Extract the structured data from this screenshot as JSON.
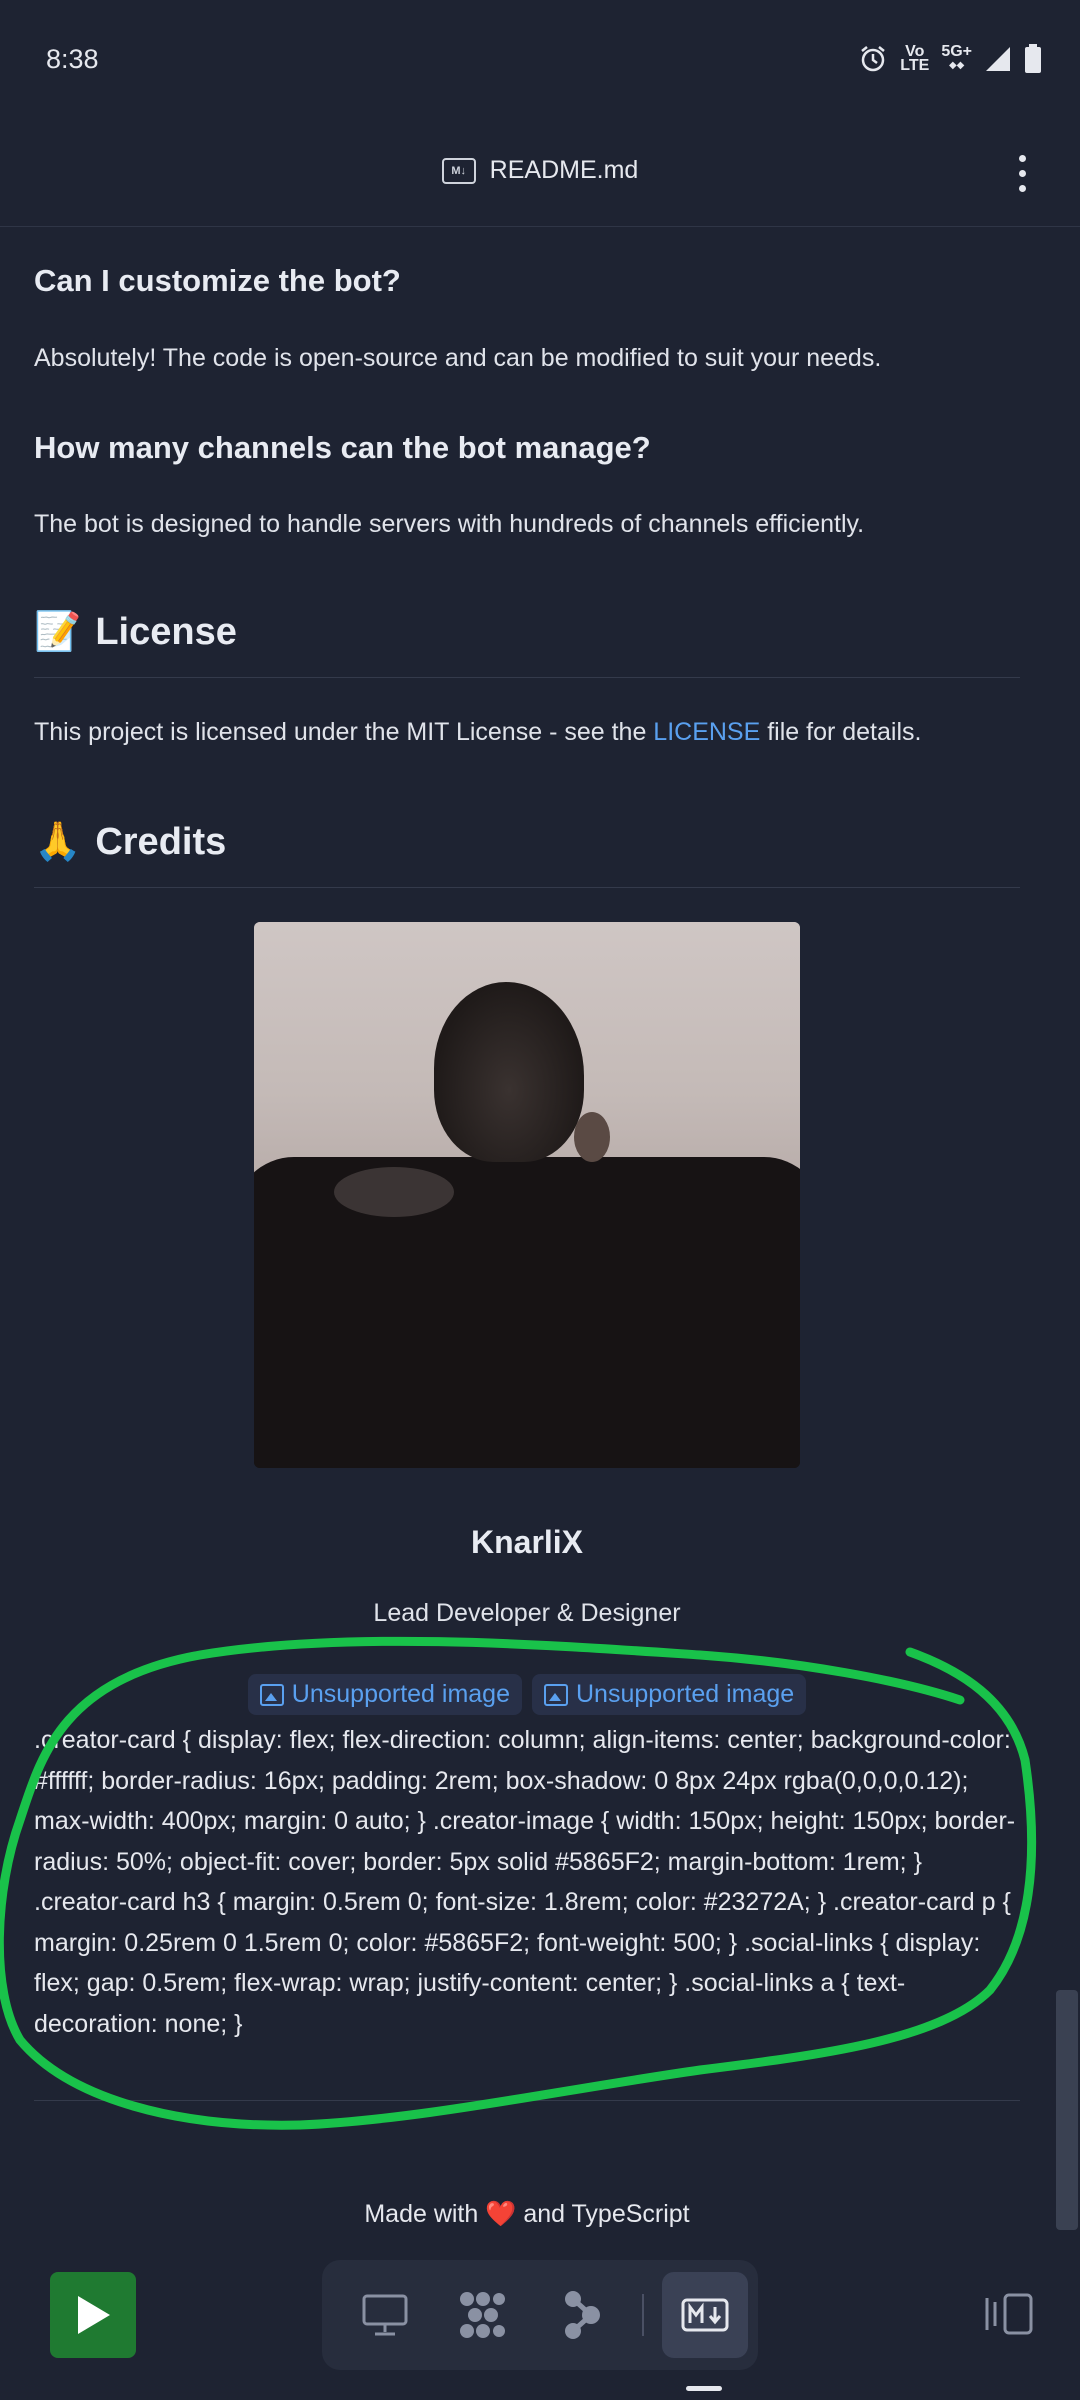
{
  "status_bar": {
    "time": "8:38",
    "icons": [
      "alarm-icon",
      "volte-icon",
      "5g-icon",
      "signal-icon",
      "battery-icon"
    ],
    "volte_top": "Vo",
    "volte_bottom": "LTE",
    "network": "5G+"
  },
  "app_bar": {
    "title": "README.md",
    "badge": "M↓"
  },
  "faq": [
    {
      "question": "Can I customize the bot?",
      "answer": "Absolutely! The code is open-source and can be modified to suit your needs."
    },
    {
      "question": "How many channels can the bot manage?",
      "answer": "The bot is designed to handle servers with hundreds of channels efficiently."
    }
  ],
  "license": {
    "emoji": "📝",
    "heading": "License",
    "text_before": "This project is licensed under the MIT License - see the ",
    "link": "LICENSE",
    "text_after": " file for details."
  },
  "credits": {
    "emoji": "🙏",
    "heading": "Credits",
    "name": "KnarliX",
    "role": "Lead Developer & Designer",
    "unsupported_images": [
      "Unsupported image",
      "Unsupported image"
    ],
    "css_text": ".creator-card { display: flex; flex-direction: column; align-items: center; background-color: #ffffff; border-radius: 16px; padding: 2rem; box-shadow: 0 8px 24px rgba(0,0,0,0.12); max-width: 400px; margin: 0 auto; } .creator-image { width: 150px; height: 150px; border-radius: 50%; object-fit: cover; border: 5px solid #5865F2; margin-bottom: 1rem; } .creator-card h3 { margin: 0.5rem 0; font-size: 1.8rem; color: #23272A; } .creator-card p { margin: 0.25rem 0 1.5rem 0; color: #5865F2; font-weight: 500; } .social-links { display: flex; gap: 0.5rem; flex-wrap: wrap; justify-content: center; } .social-links a { text-decoration: none; }"
  },
  "footer": {
    "text_before": "Made with ",
    "heart": "❤️",
    "text_after": " and TypeScript"
  },
  "colors": {
    "background": "#1e2332",
    "link": "#5aa0ef",
    "play": "#1f7a31",
    "annotation": "#19c24a"
  },
  "toolbar": {
    "play": "play-icon",
    "tools": [
      "monitor-icon",
      "dots-icon",
      "branch-icon",
      "markdown-icon"
    ],
    "active": "markdown-icon",
    "right": "split-view-icon"
  }
}
